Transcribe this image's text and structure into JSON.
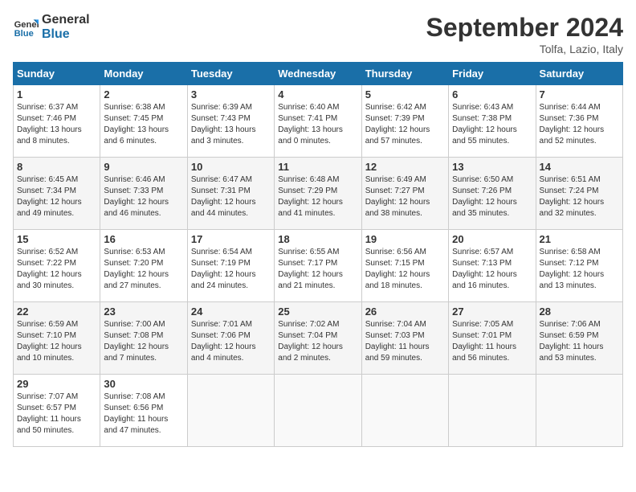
{
  "header": {
    "logo_line1": "General",
    "logo_line2": "Blue",
    "month_title": "September 2024",
    "location": "Tolfa, Lazio, Italy"
  },
  "days_of_week": [
    "Sunday",
    "Monday",
    "Tuesday",
    "Wednesday",
    "Thursday",
    "Friday",
    "Saturday"
  ],
  "weeks": [
    [
      {
        "day": "1",
        "info": "Sunrise: 6:37 AM\nSunset: 7:46 PM\nDaylight: 13 hours\nand 8 minutes."
      },
      {
        "day": "2",
        "info": "Sunrise: 6:38 AM\nSunset: 7:45 PM\nDaylight: 13 hours\nand 6 minutes."
      },
      {
        "day": "3",
        "info": "Sunrise: 6:39 AM\nSunset: 7:43 PM\nDaylight: 13 hours\nand 3 minutes."
      },
      {
        "day": "4",
        "info": "Sunrise: 6:40 AM\nSunset: 7:41 PM\nDaylight: 13 hours\nand 0 minutes."
      },
      {
        "day": "5",
        "info": "Sunrise: 6:42 AM\nSunset: 7:39 PM\nDaylight: 12 hours\nand 57 minutes."
      },
      {
        "day": "6",
        "info": "Sunrise: 6:43 AM\nSunset: 7:38 PM\nDaylight: 12 hours\nand 55 minutes."
      },
      {
        "day": "7",
        "info": "Sunrise: 6:44 AM\nSunset: 7:36 PM\nDaylight: 12 hours\nand 52 minutes."
      }
    ],
    [
      {
        "day": "8",
        "info": "Sunrise: 6:45 AM\nSunset: 7:34 PM\nDaylight: 12 hours\nand 49 minutes."
      },
      {
        "day": "9",
        "info": "Sunrise: 6:46 AM\nSunset: 7:33 PM\nDaylight: 12 hours\nand 46 minutes."
      },
      {
        "day": "10",
        "info": "Sunrise: 6:47 AM\nSunset: 7:31 PM\nDaylight: 12 hours\nand 44 minutes."
      },
      {
        "day": "11",
        "info": "Sunrise: 6:48 AM\nSunset: 7:29 PM\nDaylight: 12 hours\nand 41 minutes."
      },
      {
        "day": "12",
        "info": "Sunrise: 6:49 AM\nSunset: 7:27 PM\nDaylight: 12 hours\nand 38 minutes."
      },
      {
        "day": "13",
        "info": "Sunrise: 6:50 AM\nSunset: 7:26 PM\nDaylight: 12 hours\nand 35 minutes."
      },
      {
        "day": "14",
        "info": "Sunrise: 6:51 AM\nSunset: 7:24 PM\nDaylight: 12 hours\nand 32 minutes."
      }
    ],
    [
      {
        "day": "15",
        "info": "Sunrise: 6:52 AM\nSunset: 7:22 PM\nDaylight: 12 hours\nand 30 minutes."
      },
      {
        "day": "16",
        "info": "Sunrise: 6:53 AM\nSunset: 7:20 PM\nDaylight: 12 hours\nand 27 minutes."
      },
      {
        "day": "17",
        "info": "Sunrise: 6:54 AM\nSunset: 7:19 PM\nDaylight: 12 hours\nand 24 minutes."
      },
      {
        "day": "18",
        "info": "Sunrise: 6:55 AM\nSunset: 7:17 PM\nDaylight: 12 hours\nand 21 minutes."
      },
      {
        "day": "19",
        "info": "Sunrise: 6:56 AM\nSunset: 7:15 PM\nDaylight: 12 hours\nand 18 minutes."
      },
      {
        "day": "20",
        "info": "Sunrise: 6:57 AM\nSunset: 7:13 PM\nDaylight: 12 hours\nand 16 minutes."
      },
      {
        "day": "21",
        "info": "Sunrise: 6:58 AM\nSunset: 7:12 PM\nDaylight: 12 hours\nand 13 minutes."
      }
    ],
    [
      {
        "day": "22",
        "info": "Sunrise: 6:59 AM\nSunset: 7:10 PM\nDaylight: 12 hours\nand 10 minutes."
      },
      {
        "day": "23",
        "info": "Sunrise: 7:00 AM\nSunset: 7:08 PM\nDaylight: 12 hours\nand 7 minutes."
      },
      {
        "day": "24",
        "info": "Sunrise: 7:01 AM\nSunset: 7:06 PM\nDaylight: 12 hours\nand 4 minutes."
      },
      {
        "day": "25",
        "info": "Sunrise: 7:02 AM\nSunset: 7:04 PM\nDaylight: 12 hours\nand 2 minutes."
      },
      {
        "day": "26",
        "info": "Sunrise: 7:04 AM\nSunset: 7:03 PM\nDaylight: 11 hours\nand 59 minutes."
      },
      {
        "day": "27",
        "info": "Sunrise: 7:05 AM\nSunset: 7:01 PM\nDaylight: 11 hours\nand 56 minutes."
      },
      {
        "day": "28",
        "info": "Sunrise: 7:06 AM\nSunset: 6:59 PM\nDaylight: 11 hours\nand 53 minutes."
      }
    ],
    [
      {
        "day": "29",
        "info": "Sunrise: 7:07 AM\nSunset: 6:57 PM\nDaylight: 11 hours\nand 50 minutes."
      },
      {
        "day": "30",
        "info": "Sunrise: 7:08 AM\nSunset: 6:56 PM\nDaylight: 11 hours\nand 47 minutes."
      },
      {
        "day": "",
        "info": ""
      },
      {
        "day": "",
        "info": ""
      },
      {
        "day": "",
        "info": ""
      },
      {
        "day": "",
        "info": ""
      },
      {
        "day": "",
        "info": ""
      }
    ]
  ]
}
